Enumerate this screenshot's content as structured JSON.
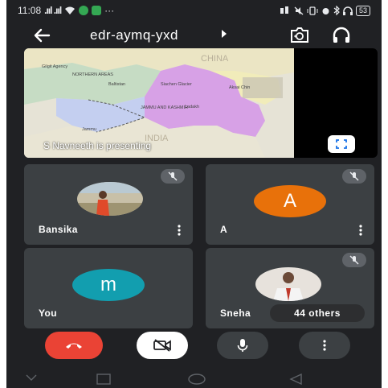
{
  "status_bar": {
    "time": "11:08",
    "signal": ".ııl .ııl",
    "more": "···",
    "battery": "53",
    "icons": [
      "signal-icon",
      "wifi-icon",
      "app-icon",
      "app-icon",
      "data-icon",
      "silent-icon",
      "vibrate-icon",
      "alarm-icon",
      "bluetooth-icon",
      "headset-icon",
      "battery-icon"
    ]
  },
  "header": {
    "meeting_code": "edr-aymq-yxd",
    "icons": [
      "back-arrow-icon",
      "caret-right-icon",
      "switch-camera-icon",
      "headphones-icon"
    ]
  },
  "presentation": {
    "label": "S Navneeth is presenting",
    "fullscreen_icon": "fullscreen-icon",
    "map_labels": {
      "china": "CHINA",
      "india": "INDIA",
      "gilgit": "Gilgit Agency",
      "northern": "NORTHERN AREAS",
      "baltistan": "Baltistan",
      "siachen": "Siachen Glacier",
      "aksai": "Aksai Chin",
      "jk": "JAMMU AND KASHMIR",
      "leh": "Ladakh",
      "jammu": "Jammu"
    }
  },
  "participants": [
    {
      "name": "Bansika",
      "muted": true,
      "avatar": "photo"
    },
    {
      "name": "A",
      "letter": "A",
      "muted": true,
      "avatar_color": "#e8710a"
    },
    {
      "name": "You",
      "letter": "m",
      "muted": false,
      "avatar_color": "#129eaf"
    },
    {
      "name": "Sneha",
      "muted": true,
      "avatar": "photo",
      "others_label": "44 others"
    }
  ],
  "controls": {
    "end_call": "end-call-icon",
    "camera": "camera-off-icon",
    "mic": "microphone-icon",
    "more": "more-vert-icon"
  },
  "navbar": [
    "nav-menu-icon",
    "nav-home-icon",
    "nav-back-icon"
  ],
  "colors": {
    "background": "#202124",
    "tile": "#3c4043",
    "end_call": "#ea4335",
    "map_purple": "#d7a1e6"
  }
}
